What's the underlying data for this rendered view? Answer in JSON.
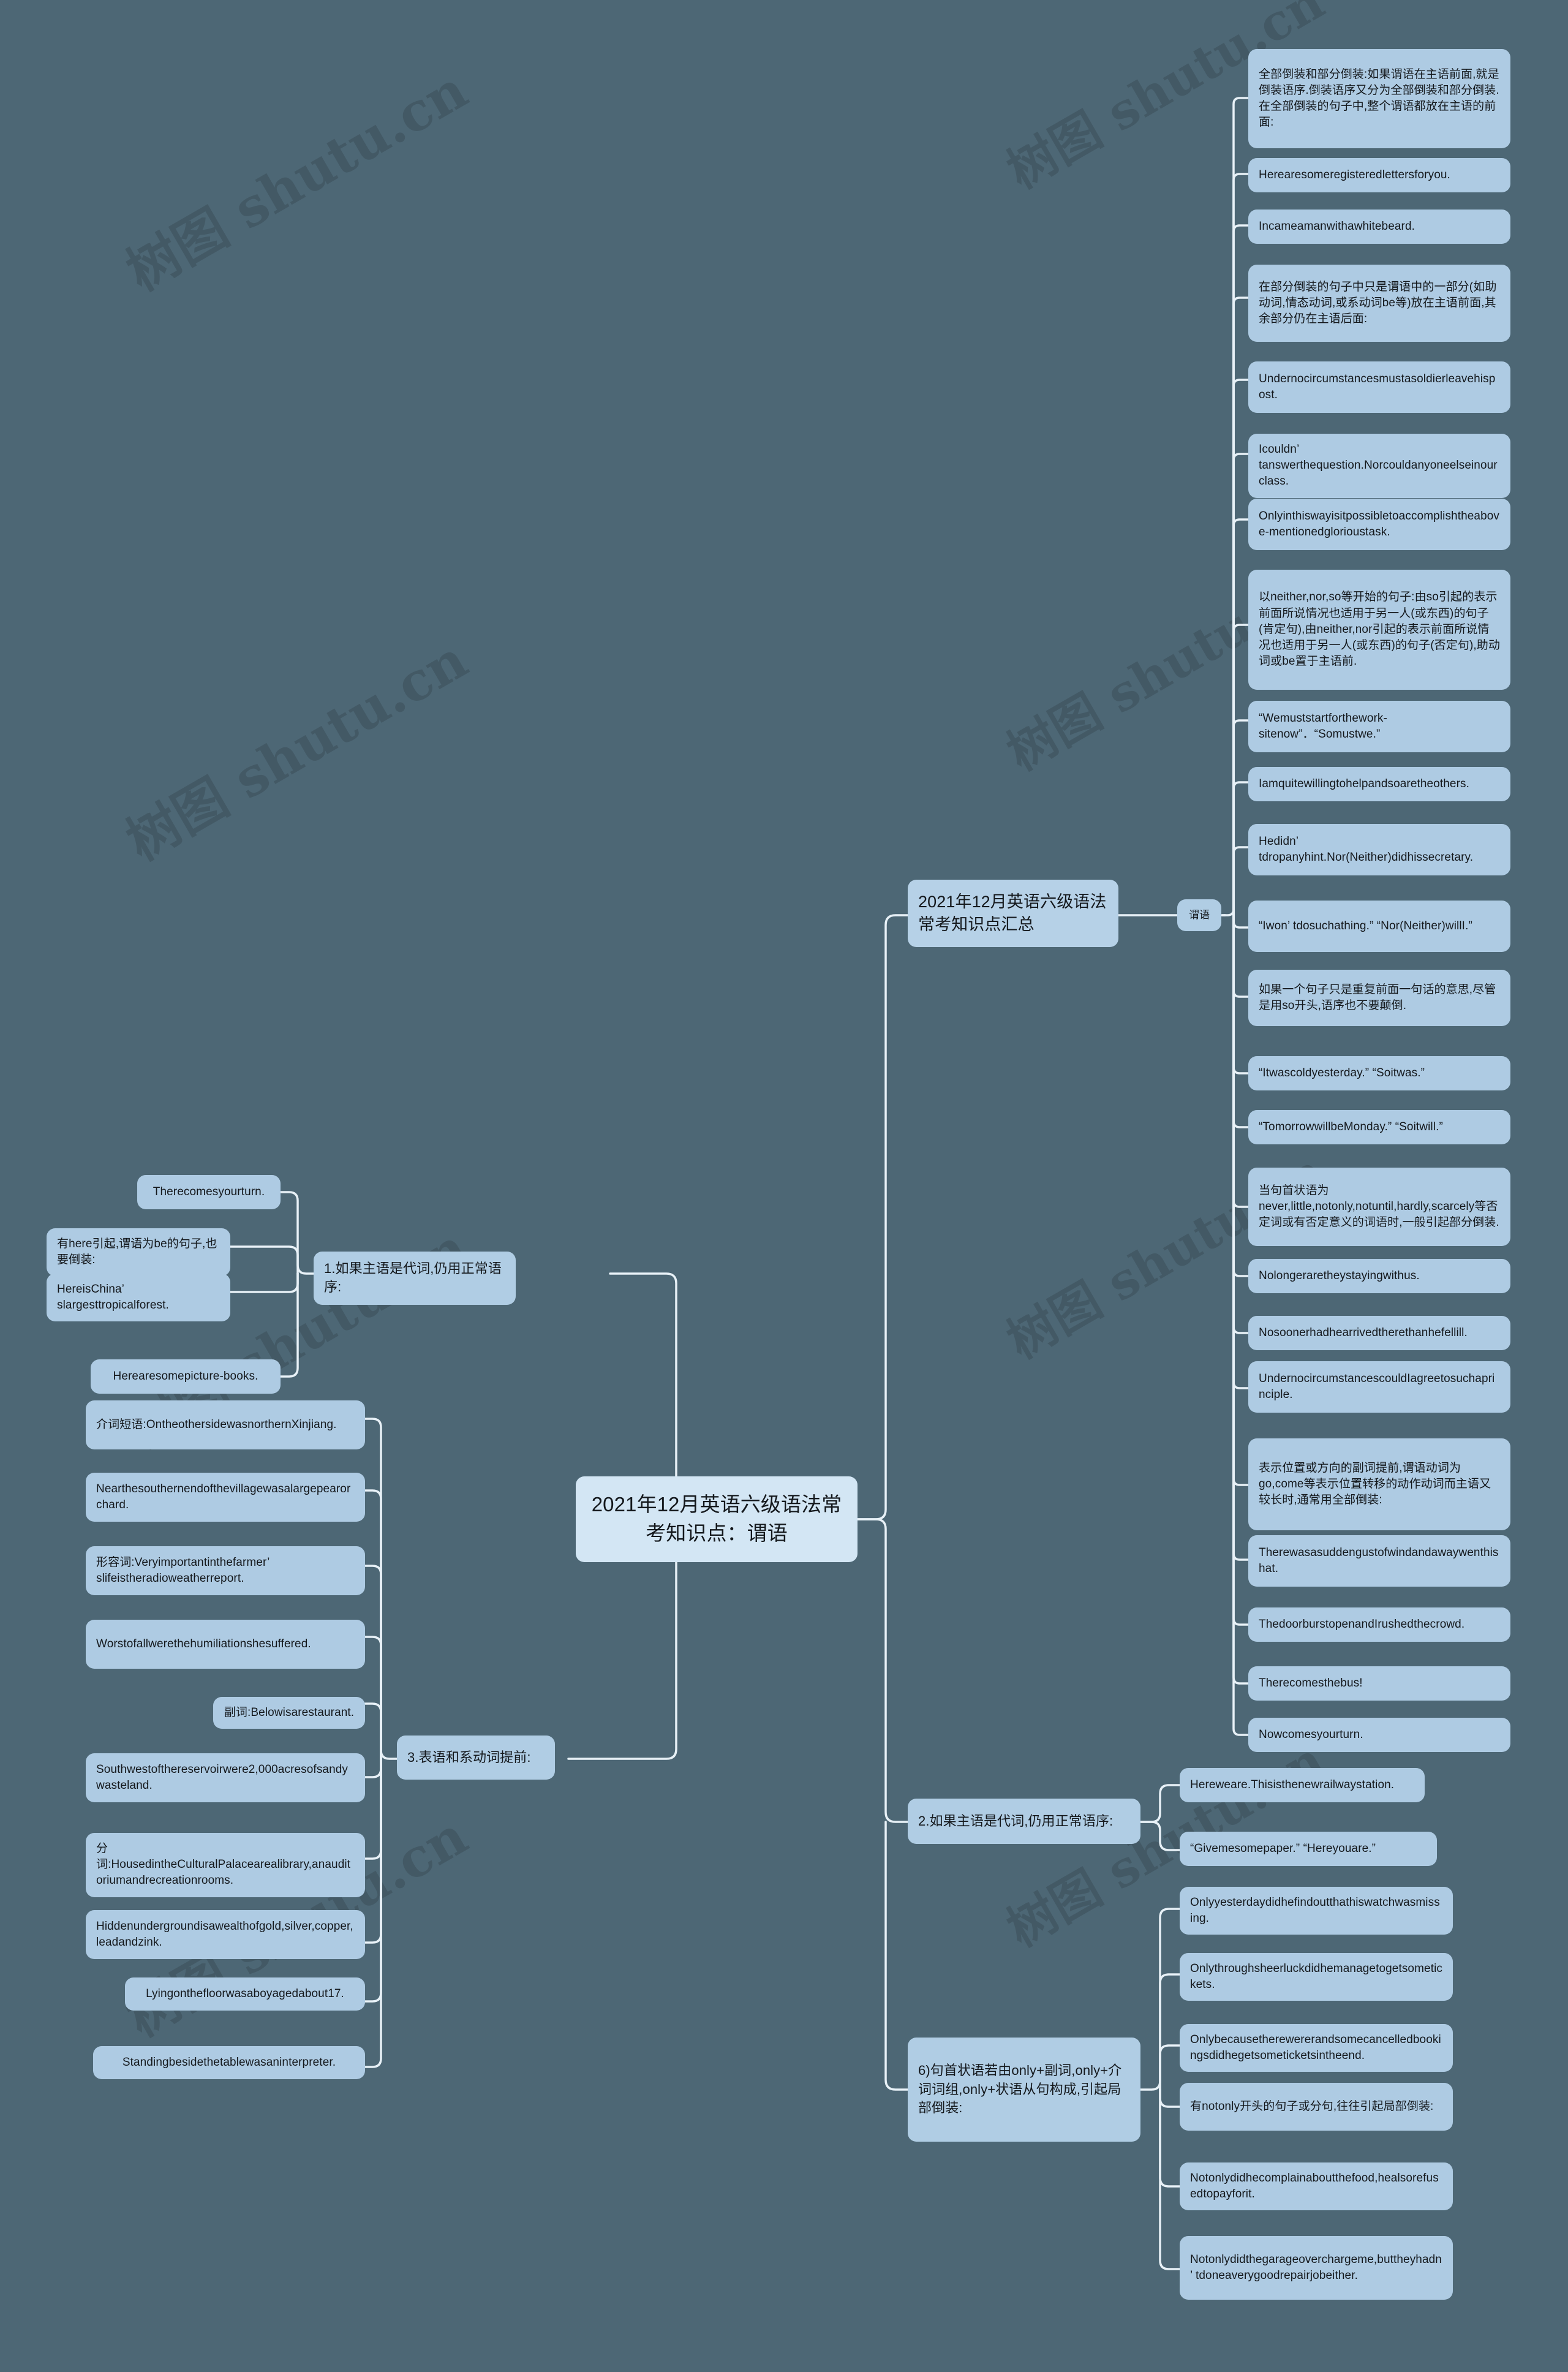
{
  "theme": {
    "background": "#4d6775",
    "node_fill": "#aecbe3",
    "root_fill": "#d3e6f4",
    "link_color": "#e8f1f7",
    "text_color": "#14181c"
  },
  "watermark_text": "树图 shutu.cn",
  "root": {
    "label": "2021年12月英语六级语法常考知识点：谓语"
  },
  "branches": {
    "topic_top": {
      "label": "2021年12月英语六级语法常考知识点汇总"
    },
    "predicate_tag": {
      "label": "谓语"
    },
    "branch1": {
      "label": "1.如果主语是代词,仍用正常语序:"
    },
    "branch3": {
      "label": "3.表语和系动词提前:"
    },
    "branch2": {
      "label": "2.如果主语是代词,仍用正常语序:"
    },
    "branch6": {
      "label": "6)句首状语若由only+副词,only+介词词组,only+状语从句构成,引起局部倒装:"
    }
  },
  "right_column": [
    {
      "id": "r1",
      "text": "全部倒装和部分倒装:如果谓语在主语前面,就是倒装语序.倒装语序又分为全部倒装和部分倒装.在全部倒装的句子中,整个谓语都放在主语的前面:"
    },
    {
      "id": "r2",
      "text": "Herearesomeregisteredlettersforyou."
    },
    {
      "id": "r3",
      "text": "Incameamanwithawhitebeard."
    },
    {
      "id": "r4",
      "text": "在部分倒装的句子中只是谓语中的一部分(如助动词,情态动词,或系动词be等)放在主语前面,其余部分仍在主语后面:"
    },
    {
      "id": "r5",
      "text": "Undernocircumstancesmustasoldierleavehispost."
    },
    {
      "id": "r6",
      "text": "Icouldn’ tanswerthequestion.Norcouldanyoneelseinourclass."
    },
    {
      "id": "r7",
      "text": "Onlyinthiswayisitpossibletoaccomplishtheabove-mentionedglorioustask."
    },
    {
      "id": "r8",
      "text": "以neither,nor,so等开始的句子:由so引起的表示前面所说情况也适用于另一人(或东西)的句子(肯定句),由neither,nor引起的表示前面所说情况也适用于另一人(或东西)的句子(否定句),助动词或be置于主语前."
    },
    {
      "id": "r9",
      "text": "“Wemuststartforthework-sitenow”．“Somustwe.”"
    },
    {
      "id": "r10",
      "text": "Iamquitewillingtohelpandsoaretheothers."
    },
    {
      "id": "r11",
      "text": "Hedidn’ tdropanyhint.Nor(Neither)didhissecretary."
    },
    {
      "id": "r12",
      "text": "“Iwon’ tdosuchathing.” “Nor(Neither)willI.”"
    },
    {
      "id": "r13",
      "text": "如果一个句子只是重复前面一句话的意思,尽管是用so开头,语序也不要颠倒."
    },
    {
      "id": "r14",
      "text": "“Itwascoldyesterday.” “Soitwas.”"
    },
    {
      "id": "r15",
      "text": "“TomorrowwillbeMonday.” “Soitwill.”"
    },
    {
      "id": "r16",
      "text": "当句首状语为never,little,notonly,notuntil,hardly,scarcely等否定词或有否定意义的词语时,一般引起部分倒装."
    },
    {
      "id": "r17",
      "text": "Nolongeraretheystayingwithus."
    },
    {
      "id": "r18",
      "text": "Nosoonerhadhearrivedtherethanhefellill."
    },
    {
      "id": "r19",
      "text": "UndernocircumstancescouldIagreetosuchaprinciple."
    },
    {
      "id": "r20",
      "text": "表示位置或方向的副词提前,谓语动词为go,come等表示位置转移的动作动词而主语又较长时,通常用全部倒装:"
    },
    {
      "id": "r21",
      "text": "Therewasasuddengustofwindandawaywenthishat."
    },
    {
      "id": "r22",
      "text": "ThedoorburstopenandIrushedthecrowd."
    },
    {
      "id": "r23",
      "text": "Therecomesthebus!"
    },
    {
      "id": "r24",
      "text": "Nowcomesyourturn."
    }
  ],
  "branch1_children": [
    {
      "id": "b1c1",
      "text": "Therecomesyourturn."
    },
    {
      "id": "b1c2",
      "text": "有here引起,谓语为be的句子,也要倒装:"
    },
    {
      "id": "b1c3",
      "text": "HereisChina’ slargesttropicalforest."
    },
    {
      "id": "b1c4",
      "text": "Herearesomepicture-books."
    }
  ],
  "branch3_children": [
    {
      "id": "b3c1",
      "text": "介词短语:OntheothersidewasnorthernXinjiang."
    },
    {
      "id": "b3c2",
      "text": "Nearthesouthernendofthevillagewasalargepearorchard."
    },
    {
      "id": "b3c3",
      "text": "形容词:Veryimportantinthefarmer’ slifeistheradioweatherreport."
    },
    {
      "id": "b3c4",
      "text": "Worstofallwerethehumiliationshesuffered."
    },
    {
      "id": "b3c5",
      "text": "副词:Belowisarestaurant."
    },
    {
      "id": "b3c6",
      "text": "Southwestofthereservoirwere2,000acresofsandywasteland."
    },
    {
      "id": "b3c7",
      "text": "分词:HousedintheCulturalPalacearealibrary,anauditoriumandrecreationrooms."
    },
    {
      "id": "b3c8",
      "text": "Hiddenundergroundisawealthofgold,silver,copper,leadandzink."
    },
    {
      "id": "b3c9",
      "text": "Lyingonthefloorwasaboyagedabout17."
    },
    {
      "id": "b3c10",
      "text": "Standingbesidethetablewasaninterpreter."
    }
  ],
  "branch2_children": [
    {
      "id": "b2c1",
      "text": "Hereweare.Thisisthenewrailwaystation."
    },
    {
      "id": "b2c2",
      "text": "“Givemesomepaper.” “Hereyouare.”"
    }
  ],
  "branch6_children": [
    {
      "id": "b6c1",
      "text": "Onlyyesterdaydidhefindoutthathiswatchwasmissing."
    },
    {
      "id": "b6c2",
      "text": "Onlythroughsheerluckdidhemanagetogetsometickets."
    },
    {
      "id": "b6c3",
      "text": "Onlybecausetherewererandsomecancelledbookingsdidhegetsometicketsintheend."
    },
    {
      "id": "b6c4",
      "text": "有notonly开头的句子或分句,往往引起局部倒装:"
    },
    {
      "id": "b6c5",
      "text": "Notonlydidhecomplainaboutthefood,healsorefusedtopayforit."
    },
    {
      "id": "b6c6",
      "text": "Notonlydidthegarageoverchargeme,buttheyhadn’ tdoneaverygoodrepairjobeither."
    }
  ]
}
